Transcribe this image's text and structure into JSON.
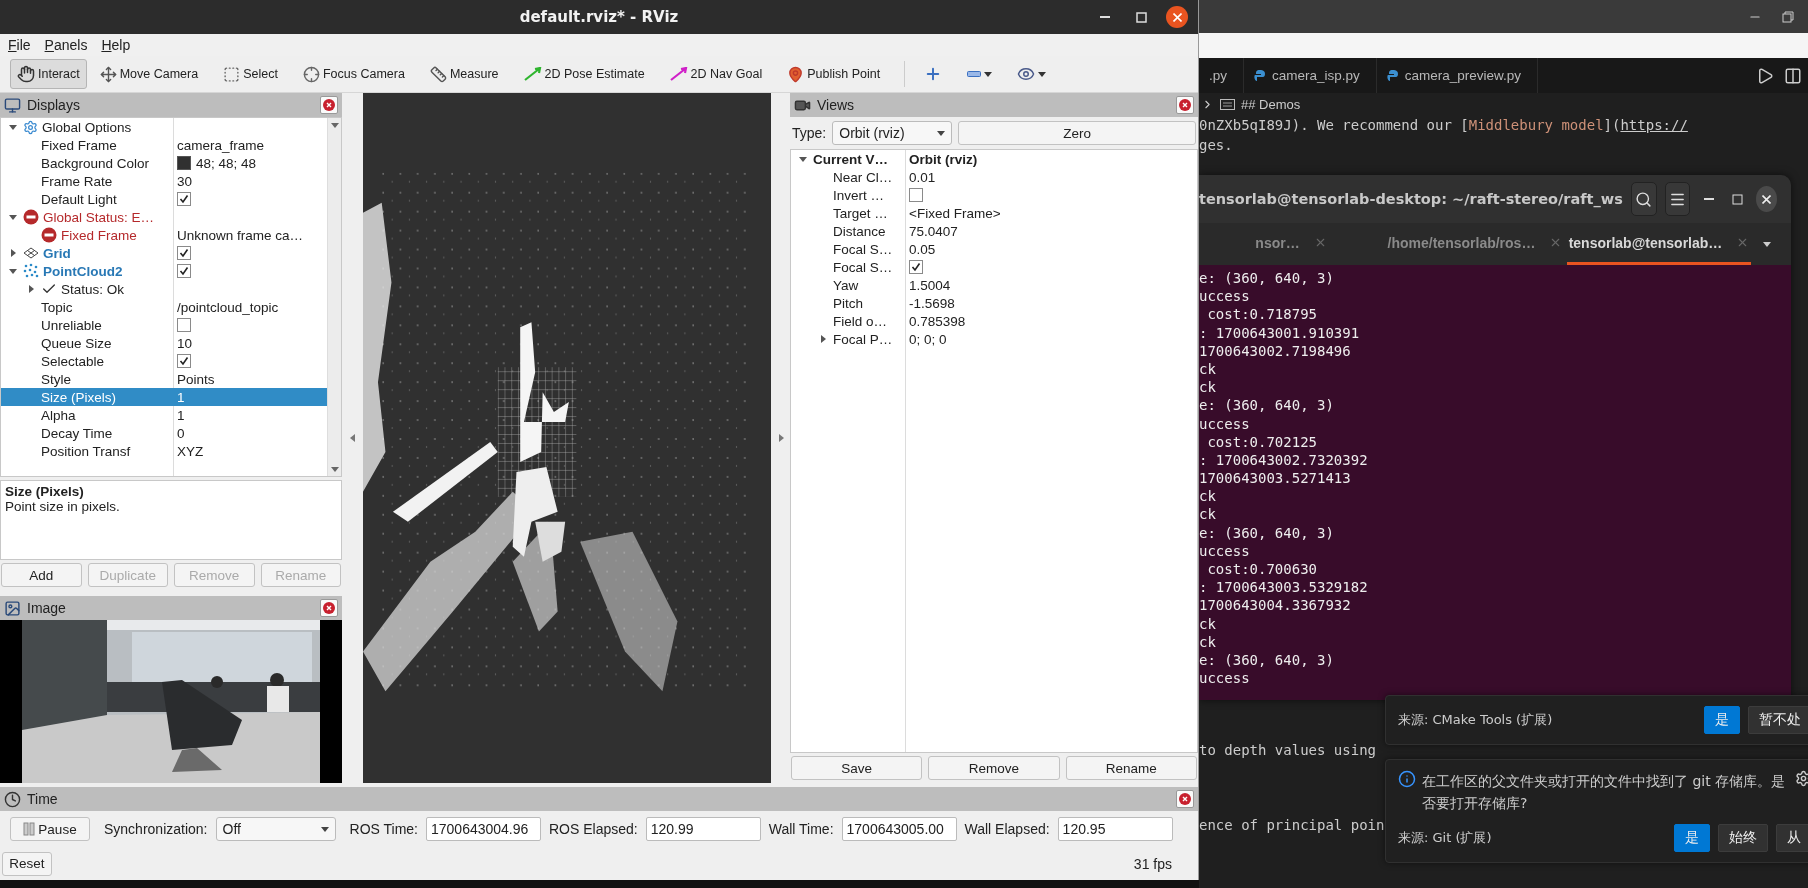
{
  "rviz": {
    "title": "default.rviz* - RViz",
    "menu": [
      "File",
      "Panels",
      "Help"
    ],
    "tools": [
      {
        "kind": "interact",
        "label": "Interact",
        "selected": true
      },
      {
        "kind": "move_camera",
        "label": "Move Camera",
        "selected": false
      },
      {
        "kind": "select",
        "label": "Select",
        "selected": false
      },
      {
        "kind": "focus_camera",
        "label": "Focus Camera",
        "selected": false
      },
      {
        "kind": "measure",
        "label": "Measure",
        "selected": false
      },
      {
        "kind": "pose_estimate",
        "label": "2D Pose Estimate",
        "selected": false
      },
      {
        "kind": "nav_goal",
        "label": "2D Nav Goal",
        "selected": false
      },
      {
        "kind": "publish_point",
        "label": "Publish Point",
        "selected": false
      },
      {
        "kind": "add",
        "selected": false
      },
      {
        "kind": "remove",
        "selected": false
      },
      {
        "kind": "view",
        "selected": false
      }
    ],
    "displays": {
      "title": "Displays",
      "tree": [
        {
          "name": "Global Options",
          "kind": "options",
          "expanded": true,
          "selected": false,
          "children": [
            {
              "name": "Fixed Frame",
              "value": "camera_frame",
              "selected": false
            },
            {
              "name": "Background Color",
              "value": "48; 48; 48",
              "color": "#303030",
              "selected": false
            },
            {
              "name": "Frame Rate",
              "value": "30",
              "selected": false
            },
            {
              "name": "Default Light",
              "checked": true,
              "selected": false
            }
          ]
        },
        {
          "name": "Global Status: E…",
          "kind": "error",
          "expanded": true,
          "selected": false,
          "children": [
            {
              "name": "Fixed Frame",
              "kind": "error",
              "value": "Unknown frame ca…",
              "selected": false
            }
          ]
        },
        {
          "name": "Grid",
          "kind": "grid",
          "expanded": false,
          "checked": true,
          "selected": false
        },
        {
          "name": "PointCloud2",
          "kind": "pointcloud",
          "expanded": true,
          "checked": true,
          "selected": false,
          "children": [
            {
              "name": "Status: Ok",
              "kind": "ok",
              "expanded": false,
              "selected": false
            },
            {
              "name": "Topic",
              "value": "/pointcloud_topic",
              "selected": false
            },
            {
              "name": "Unreliable",
              "checked": false,
              "selected": false
            },
            {
              "name": "Queue Size",
              "value": "10",
              "selected": false
            },
            {
              "name": "Selectable",
              "checked": true,
              "selected": false
            },
            {
              "name": "Style",
              "value": "Points",
              "selected": false
            },
            {
              "name": "Size (Pixels)",
              "value": "1",
              "selected": true
            },
            {
              "name": "Alpha",
              "value": "1",
              "selected": false
            },
            {
              "name": "Decay Time",
              "value": "0",
              "selected": false
            },
            {
              "name": "Position Transf",
              "value": "XYZ",
              "selected": false
            }
          ]
        }
      ],
      "description": {
        "title": "Size (Pixels)",
        "text": "Point size in pixels."
      },
      "buttons": [
        {
          "label": "Add",
          "disabled": false
        },
        {
          "label": "Duplicate",
          "disabled": true
        },
        {
          "label": "Remove",
          "disabled": true
        },
        {
          "label": "Rename",
          "disabled": true
        }
      ]
    },
    "image": {
      "title": "Image"
    },
    "views": {
      "title": "Views",
      "type_label": "Type:",
      "type_value": "Orbit (rviz)",
      "zero": "Zero",
      "tree": [
        {
          "name": "Current V…",
          "value": "Orbit (rviz)",
          "kind": "header",
          "expanded": true,
          "selected": false,
          "children": [
            {
              "name": "Near Cl…",
              "value": "0.01",
              "selected": false
            },
            {
              "name": "Invert …",
              "checked": false,
              "selected": false
            },
            {
              "name": "Target …",
              "value": "<Fixed Frame>",
              "selected": false
            },
            {
              "name": "Distance",
              "value": "75.0407",
              "selected": false
            },
            {
              "name": "Focal S…",
              "value": "0.05",
              "selected": false
            },
            {
              "name": "Focal S…",
              "checked": true,
              "selected": false
            },
            {
              "name": "Yaw",
              "value": "1.5004",
              "selected": false
            },
            {
              "name": "Pitch",
              "value": "-1.5698",
              "selected": false
            },
            {
              "name": "Field o…",
              "value": "0.785398",
              "selected": false
            },
            {
              "name": "Focal P…",
              "value": "0; 0; 0",
              "expanded": false,
              "selected": false
            }
          ]
        }
      ],
      "buttons": [
        "Save",
        "Remove",
        "Rename"
      ]
    },
    "time": {
      "title": "Time",
      "pause": "Pause",
      "sync_label": "Synchronization:",
      "sync_value": "Off",
      "fields": [
        {
          "label": "ROS Time:",
          "value": "1700643004.96"
        },
        {
          "label": "ROS Elapsed:",
          "value": "120.99"
        },
        {
          "label": "Wall Time:",
          "value": "1700643005.00"
        },
        {
          "label": "Wall Elapsed:",
          "value": "120.95"
        }
      ],
      "reset": "Reset",
      "fps": "31 fps"
    }
  },
  "editor": {
    "tabs": [
      {
        "label": ".py",
        "selected": false
      },
      {
        "label": "camera_isp.py",
        "selected": false
      },
      {
        "label": "camera_preview.py",
        "selected": false
      }
    ],
    "breadcrumb": "## Demos",
    "top_lines": [
      [
        {
          "text": "0nZXb5qI89J). We recommend our [",
          "kind": "plain"
        },
        {
          "text": "Middlebury model",
          "kind": "link"
        },
        {
          "text": "](",
          "kind": "plain"
        },
        {
          "text": "https://",
          "kind": "url"
        }
      ],
      [
        {
          "text": "ges.",
          "kind": "plain"
        }
      ]
    ],
    "bottom_lines": [
      "to depth values using",
      "ence of principal poin"
    ]
  },
  "terminal": {
    "title": "tensorlab@tensorlab-desktop: ~/raft-stereo/raft_ws",
    "tabs": [
      {
        "label": "nsor…",
        "selected": false
      },
      {
        "label": "/home/tensorlab/ros…",
        "selected": false
      },
      {
        "label": "tensorlab@tensorlab…",
        "selected": true
      }
    ],
    "lines": [
      "e: (360, 640, 3)",
      "uccess",
      " cost:0.718795",
      ": 1700643001.910391",
      "1700643002.7198496",
      "ck",
      "ck",
      "e: (360, 640, 3)",
      "uccess",
      " cost:0.702125",
      ": 1700643002.7320392",
      "1700643003.5271413",
      "ck",
      "ck",
      "e: (360, 640, 3)",
      "uccess",
      " cost:0.700630",
      ": 1700643003.5329182",
      "1700643004.3367932",
      "ck",
      "ck",
      "e: (360, 640, 3)",
      "uccess"
    ]
  },
  "notifications": [
    {
      "source": "来源: CMake Tools (扩展)",
      "buttons": [
        {
          "label": "是",
          "primary": true
        },
        {
          "label": "暂不处",
          "primary": false
        }
      ]
    },
    {
      "message": "在工作区的父文件夹或打开的文件中找到了 git 存储库。是否要打开存储库?",
      "source": "来源: Git (扩展)",
      "buttons": [
        {
          "label": "是",
          "primary": true
        },
        {
          "label": "始终",
          "primary": false
        },
        {
          "label": "从",
          "primary": false
        }
      ]
    }
  ]
}
